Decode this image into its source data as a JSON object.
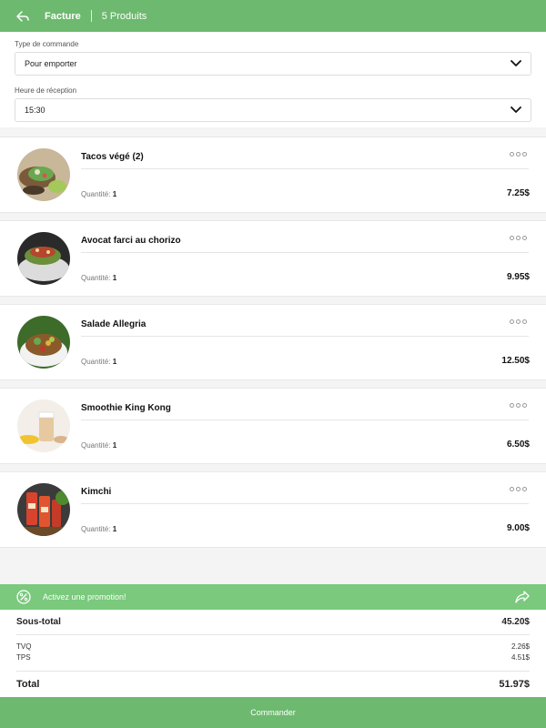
{
  "header": {
    "title": "Facture",
    "count": "5 Produits"
  },
  "form": {
    "order_type_label": "Type de commande",
    "order_type_value": "Pour emporter",
    "pickup_time_label": "Heure de réception",
    "pickup_time_value": "15:30"
  },
  "items": [
    {
      "name": "Tacos végé (2)",
      "qty_label": "Quantité:",
      "qty": "1",
      "price": "7.25$"
    },
    {
      "name": "Avocat farci au chorizo",
      "qty_label": "Quantité:",
      "qty": "1",
      "price": "9.95$"
    },
    {
      "name": "Salade Allegria",
      "qty_label": "Quantité:",
      "qty": "1",
      "price": "12.50$"
    },
    {
      "name": "Smoothie King Kong",
      "qty_label": "Quantité:",
      "qty": "1",
      "price": "6.50$"
    },
    {
      "name": "Kimchi",
      "qty_label": "Quantité:",
      "qty": "1",
      "price": "9.00$"
    }
  ],
  "promo": {
    "text": "Activez une promotion!"
  },
  "totals": {
    "subtotal_label": "Sous-total",
    "subtotal": "45.20$",
    "tvq_label": "TVQ",
    "tvq": "2.26$",
    "tps_label": "TPS",
    "tps": "4.51$",
    "total_label": "Total",
    "total": "51.97$"
  },
  "order_button": "Commander",
  "colors": {
    "accent": "#6db96f",
    "promo": "#7ac97d"
  }
}
